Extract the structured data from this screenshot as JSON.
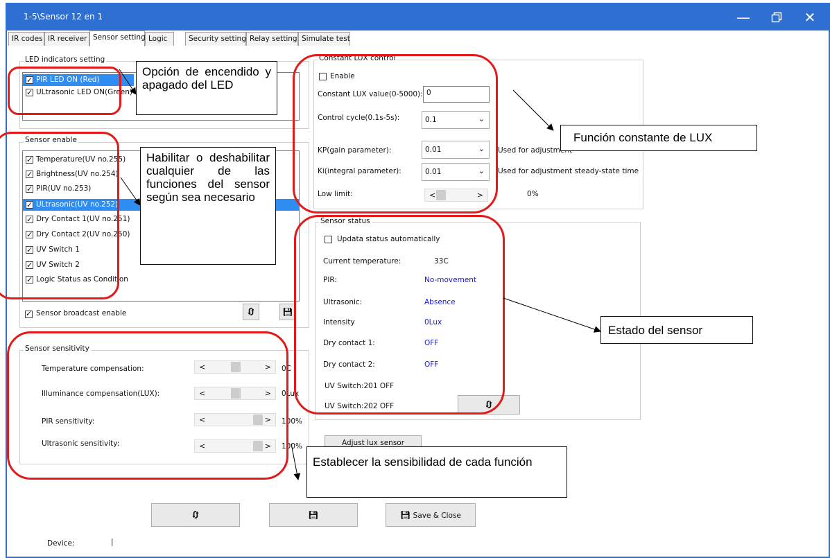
{
  "window": {
    "title": "1-5\\Sensor 12 en 1",
    "controls": [
      "minimize",
      "restore",
      "close"
    ]
  },
  "tabs": [
    "IR codes",
    "IR receiver",
    "Sensor setting",
    "Logic",
    "Security setting",
    "Relay setting",
    "Simulate test"
  ],
  "active_tab": "Sensor setting",
  "led": {
    "group_label": "LED indicators setting",
    "items": [
      {
        "label": "PIR LED ON   (Red)",
        "checked": true,
        "selected": true
      },
      {
        "label": "ULtrasonic LED ON(Green)",
        "checked": true,
        "selected": false
      }
    ]
  },
  "sensor_enable": {
    "group_label": "Sensor enable",
    "items": [
      {
        "label": "Temperature(UV no.255)",
        "checked": true
      },
      {
        "label": "Brightness(UV no.254)",
        "checked": true
      },
      {
        "label": "PIR(UV no.253)",
        "checked": true
      },
      {
        "label": "ULtrasonic(UV no.252)",
        "checked": true
      },
      {
        "label": "Dry Contact 1(UV no.251)",
        "checked": true
      },
      {
        "label": "Dry Contact 2(UV no.250)",
        "checked": true
      },
      {
        "label": "UV Switch 1",
        "checked": true
      },
      {
        "label": "UV Switch 2",
        "checked": true
      },
      {
        "label": "Logic Status as Condition",
        "checked": true
      }
    ],
    "broadcast_label": "Sensor broadcast enable",
    "broadcast_checked": true
  },
  "sensitivity": {
    "group_label": "Sensor sensitivity",
    "rows": [
      {
        "label": "Temperature compensation:",
        "value": "0C",
        "level": 0.5
      },
      {
        "label": "Illuminance compensation(LUX):",
        "value": "0Lux",
        "level": 0.5
      },
      {
        "label": "PIR sensitivity:",
        "value": "100%",
        "level": 1.0
      },
      {
        "label": "Ultrasonic sensitivity:",
        "value": "100%",
        "level": 1.0
      }
    ]
  },
  "lux": {
    "group_label": "Constant LUX control",
    "enable_label": "Enable",
    "enable_checked": false,
    "value_label": "Constant LUX value(0-5000):",
    "value": "0",
    "cycle_label": "Control cycle(0.1s-5s):",
    "cycle_value": "0.1",
    "kp_label": "KP(gain parameter):",
    "kp_value": "0.01",
    "kp_note": "Used for adjustment",
    "ki_label": "Ki(integral parameter):",
    "ki_value": "0.01",
    "ki_note": "Used for adjustment steady-state time",
    "low_label": "Low limit:",
    "low_value": "0%",
    "low_level": 0.0
  },
  "status": {
    "group_label": "Sensor status",
    "auto_label": "Updata status automatically",
    "auto_checked": false,
    "rows": [
      {
        "label": "Current temperature:",
        "value": "33C",
        "blue": false
      },
      {
        "label": "PIR:",
        "value": "No-movement",
        "blue": true
      },
      {
        "label": "Ultrasonic:",
        "value": "Absence",
        "blue": true
      },
      {
        "label": "Intensity",
        "value": "0Lux",
        "blue": true
      },
      {
        "label": "Dry contact 1:",
        "value": "OFF",
        "blue": true
      },
      {
        "label": "Dry contact 2:",
        "value": "OFF",
        "blue": true
      }
    ],
    "uv1": "UV Switch:201 OFF",
    "uv2": "UV Switch:202 OFF",
    "adjust_label": "Adjust lux sensor"
  },
  "bottom": {
    "save_close_label": "Save & Close",
    "device_label": "Device:"
  },
  "callouts": {
    "led": "Opción de encendido y apagado del LED",
    "enable": "Habilitar o deshabilitar cualquier de las funciones del sensor según sea necesario",
    "lux": "Función constante de LUX",
    "status": "Estado del sensor",
    "sensitivity": "Establecer la sensibilidad de cada función"
  },
  "colors": {
    "title_bar": "#2f6fd1",
    "selection": "#2f8cf0",
    "status_value": "#1a1ad6",
    "annotation": "#e31a1a"
  }
}
